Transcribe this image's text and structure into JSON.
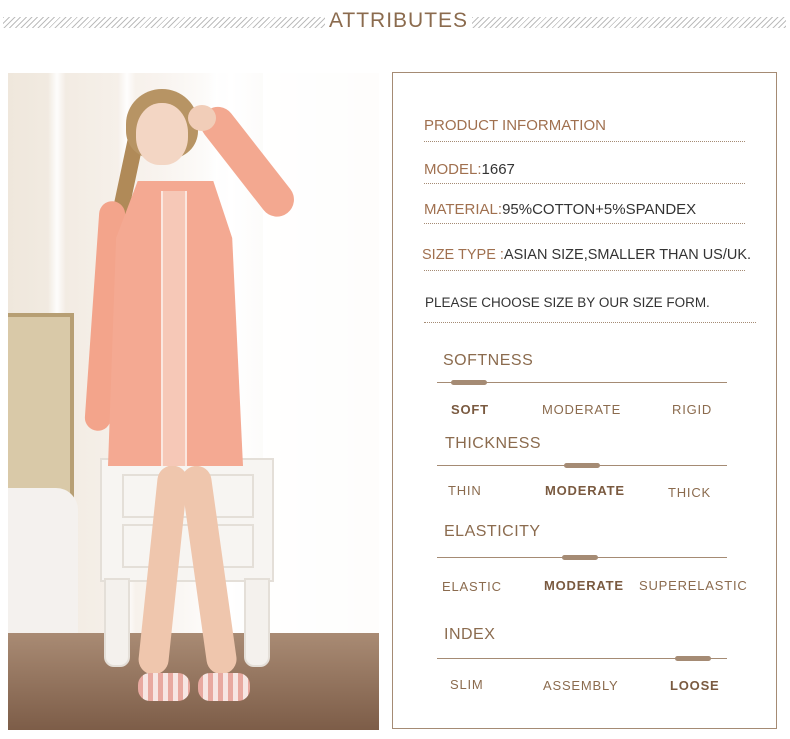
{
  "header": {
    "title": "ATTRIBUTES"
  },
  "product_info": {
    "heading": "PRODUCT INFORMATION",
    "model_label": "MODEL:",
    "model_value": "1667",
    "material_label": "MATERIAL:",
    "material_value": "95%COTTON+5%SPANDEX",
    "size_type_label": "SIZE TYPE :",
    "size_type_value": "ASIAN SIZE,SMALLER THAN US/UK.",
    "size_note": "PLEASE CHOOSE SIZE BY OUR SIZE FORM."
  },
  "attributes": [
    {
      "title": "SOFTNESS",
      "options": [
        "SOFT",
        "MODERATE",
        "RIGID"
      ],
      "selected_index": 0
    },
    {
      "title": "THICKNESS",
      "options": [
        "THIN",
        "MODERATE",
        "THICK"
      ],
      "selected_index": 1
    },
    {
      "title": "ELASTICITY",
      "options": [
        "ELASTIC",
        "MODERATE",
        "SUPERELASTIC"
      ],
      "selected_index": 1
    },
    {
      "title": "INDEX",
      "options": [
        "SLIM",
        "ASSEMBLY",
        "LOOSE"
      ],
      "selected_index": 2
    }
  ],
  "colors": {
    "accent": "#a58b74",
    "label": "#a0704f",
    "dress": "#f4a992"
  }
}
